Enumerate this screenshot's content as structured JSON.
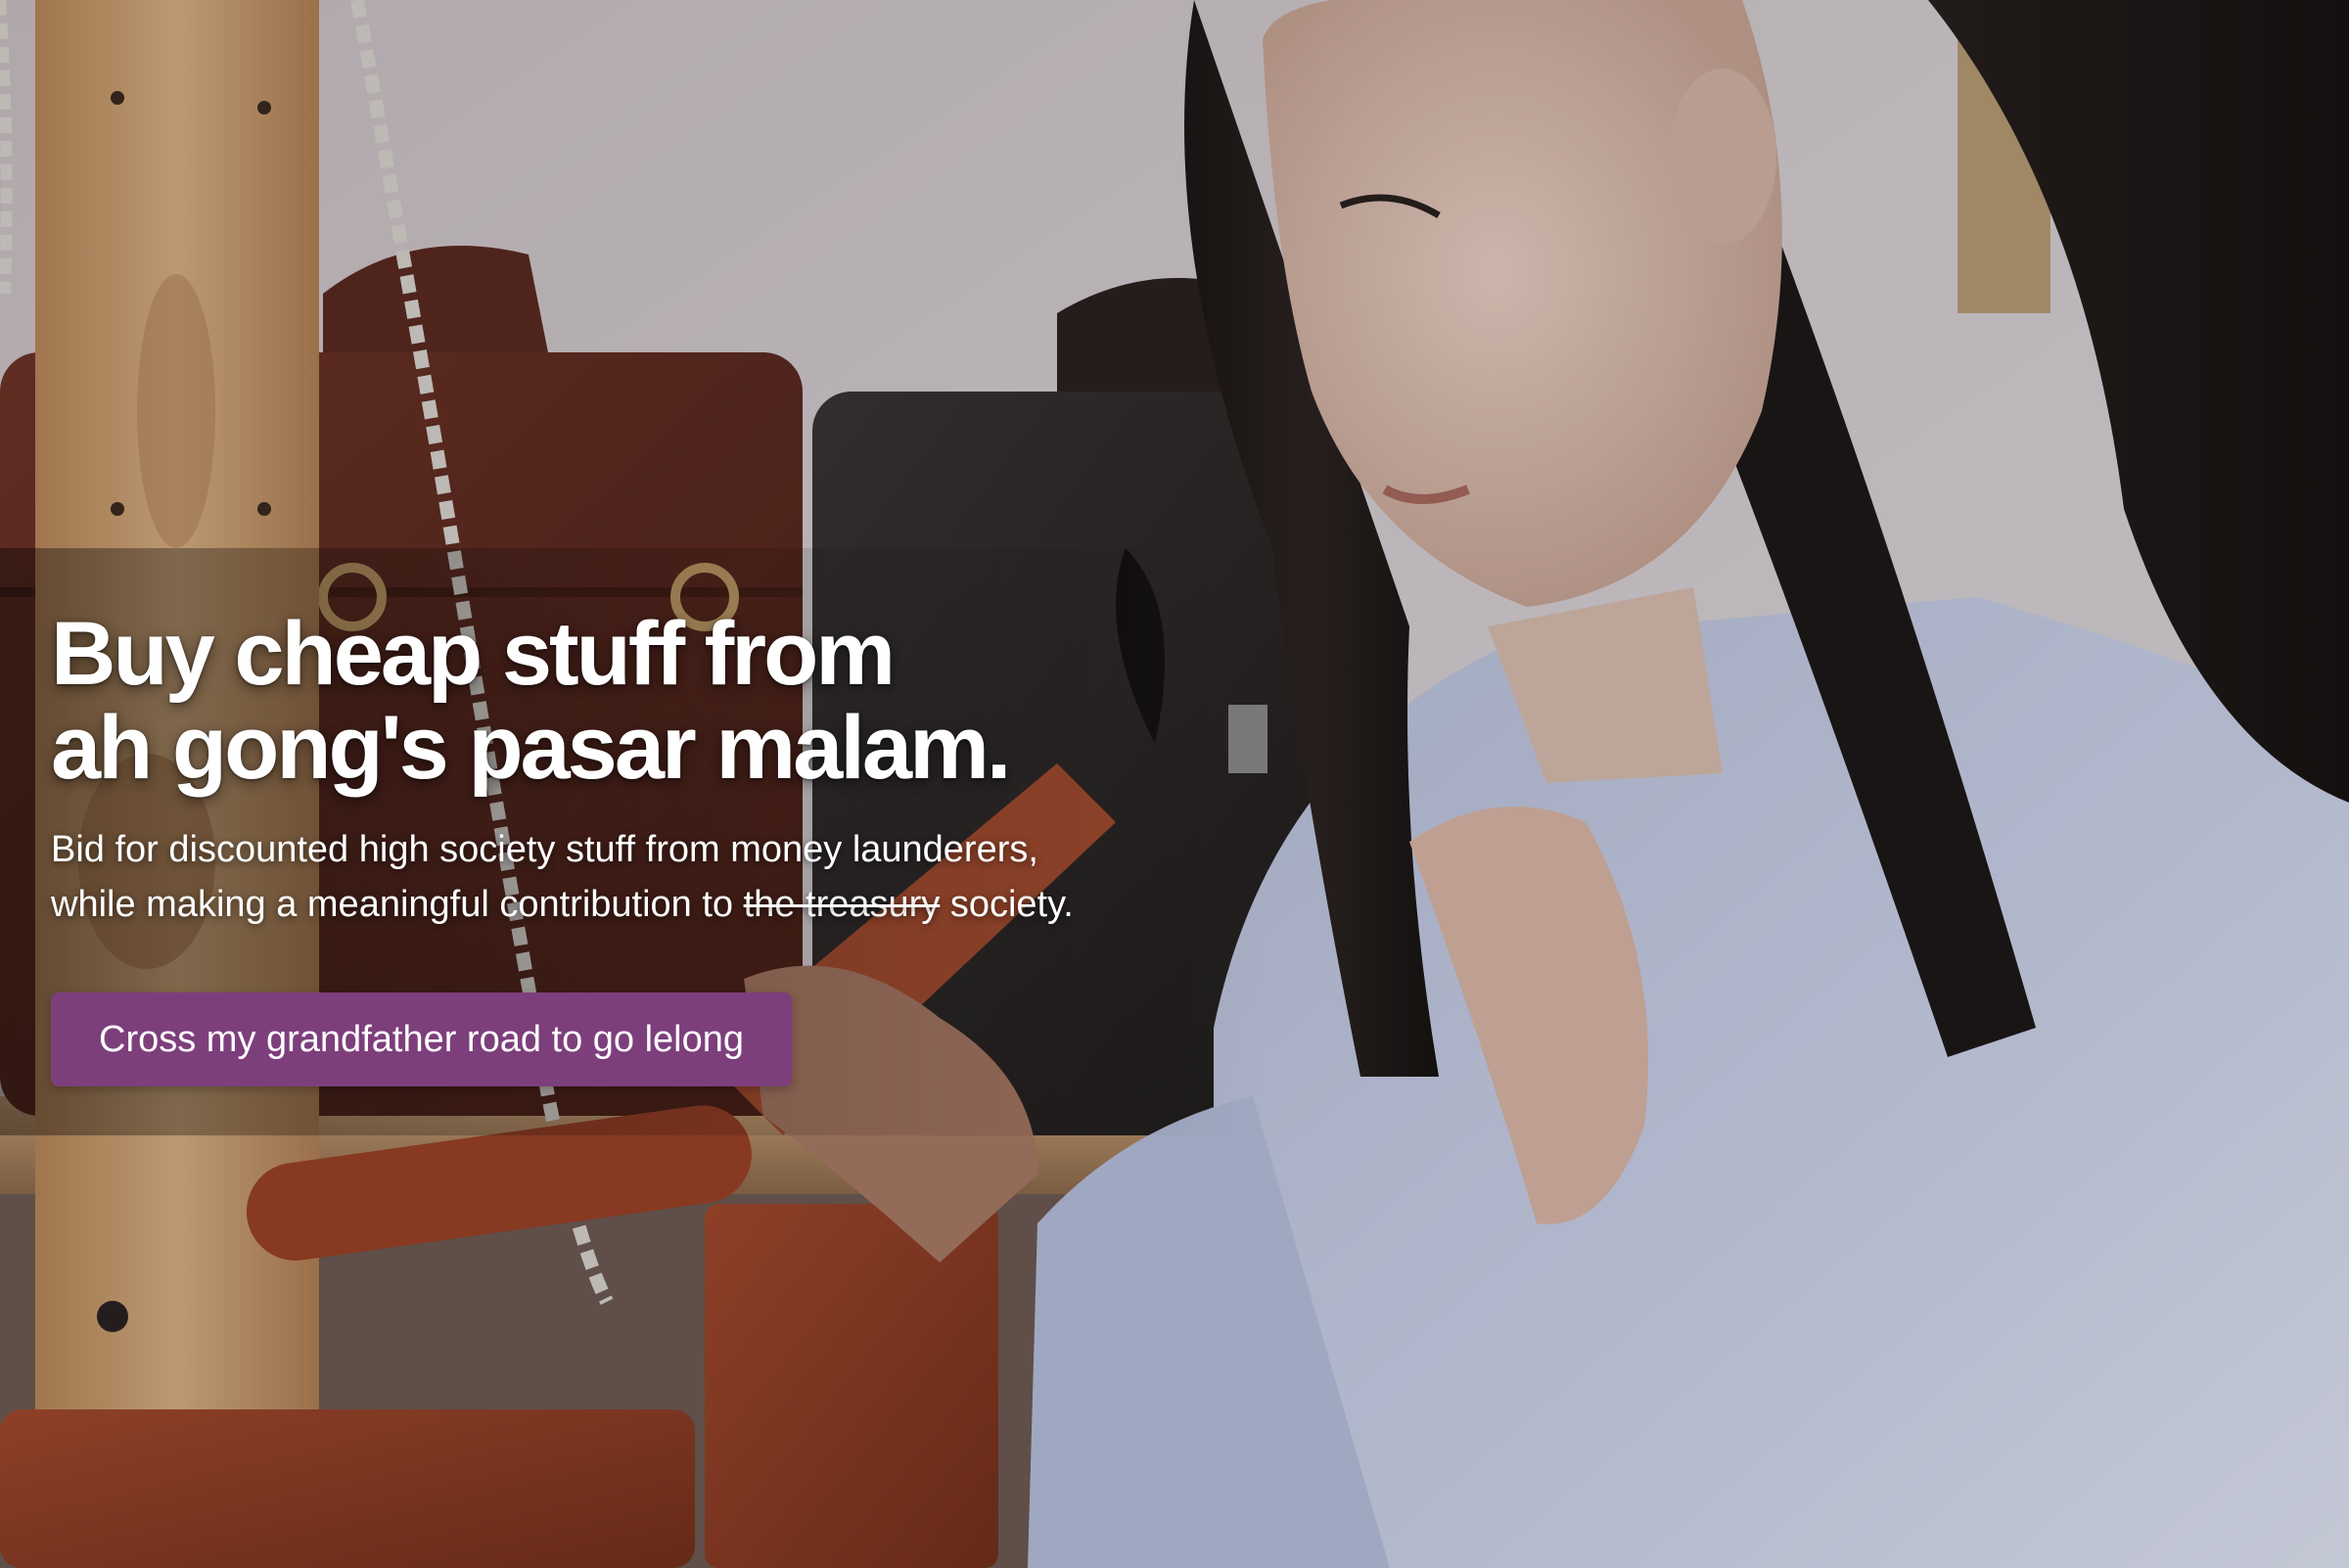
{
  "hero": {
    "headline_line1": "Buy cheap stuff from",
    "headline_line2": "ah gong's pasar malam.",
    "subhead_line1": "Bid for discounted high society stuff from money launderers,",
    "subhead_line2_before": "while making a meaningful contribution to ",
    "subhead_struck": "the treasury",
    "subhead_line2_after": " society.",
    "cta_label": "Cross my grandfather road to go lelong"
  },
  "colors": {
    "cta_background": "#7d3f7c",
    "text": "#ffffff"
  }
}
